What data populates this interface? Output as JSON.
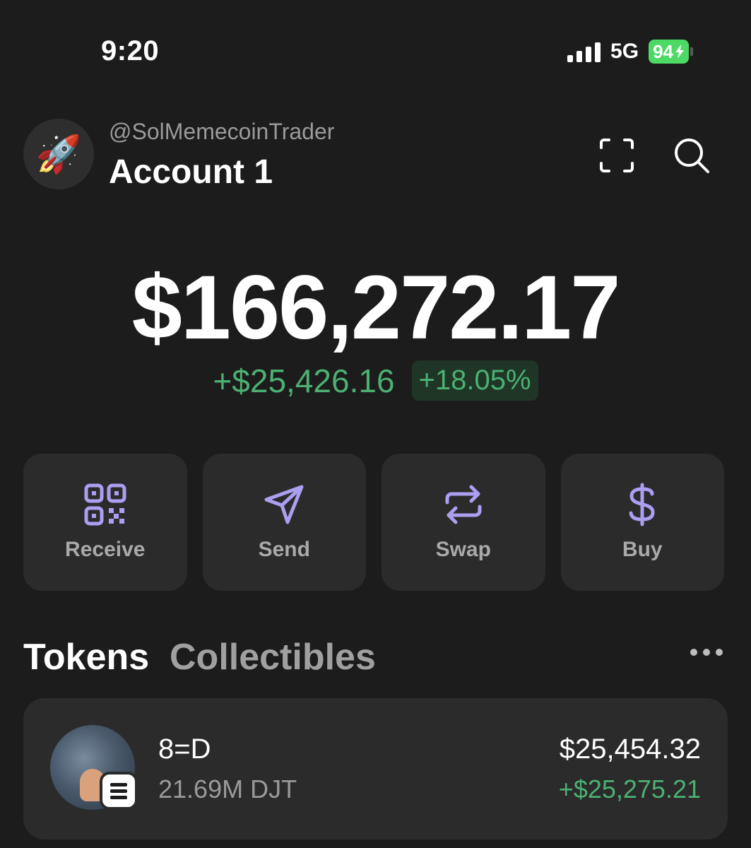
{
  "status_bar": {
    "time": "9:20",
    "network": "5G",
    "battery": "94",
    "battery_color": "#4cd964"
  },
  "account": {
    "avatar_icon": "rocket-icon",
    "handle": "@SolMemecoinTrader",
    "name": "Account 1"
  },
  "header_icons": [
    "scan-icon",
    "search-icon"
  ],
  "portfolio": {
    "balance": "$166,272.17",
    "change_value": "+$25,426.16",
    "change_percent": "+18.05%",
    "positive_color": "#4bb072"
  },
  "actions": [
    {
      "label": "Receive",
      "icon": "qr-code-icon"
    },
    {
      "label": "Send",
      "icon": "send-icon"
    },
    {
      "label": "Swap",
      "icon": "swap-icon"
    },
    {
      "label": "Buy",
      "icon": "dollar-icon"
    }
  ],
  "accent_color": "#ab9ff2",
  "tabs": {
    "tokens": "Tokens",
    "collectibles": "Collectibles",
    "active": "Tokens"
  },
  "tokens": [
    {
      "name": "8=D",
      "amount": "21.69M DJT",
      "value": "$25,454.32",
      "change": "+$25,275.21",
      "chain_icon": "solana-icon"
    }
  ]
}
